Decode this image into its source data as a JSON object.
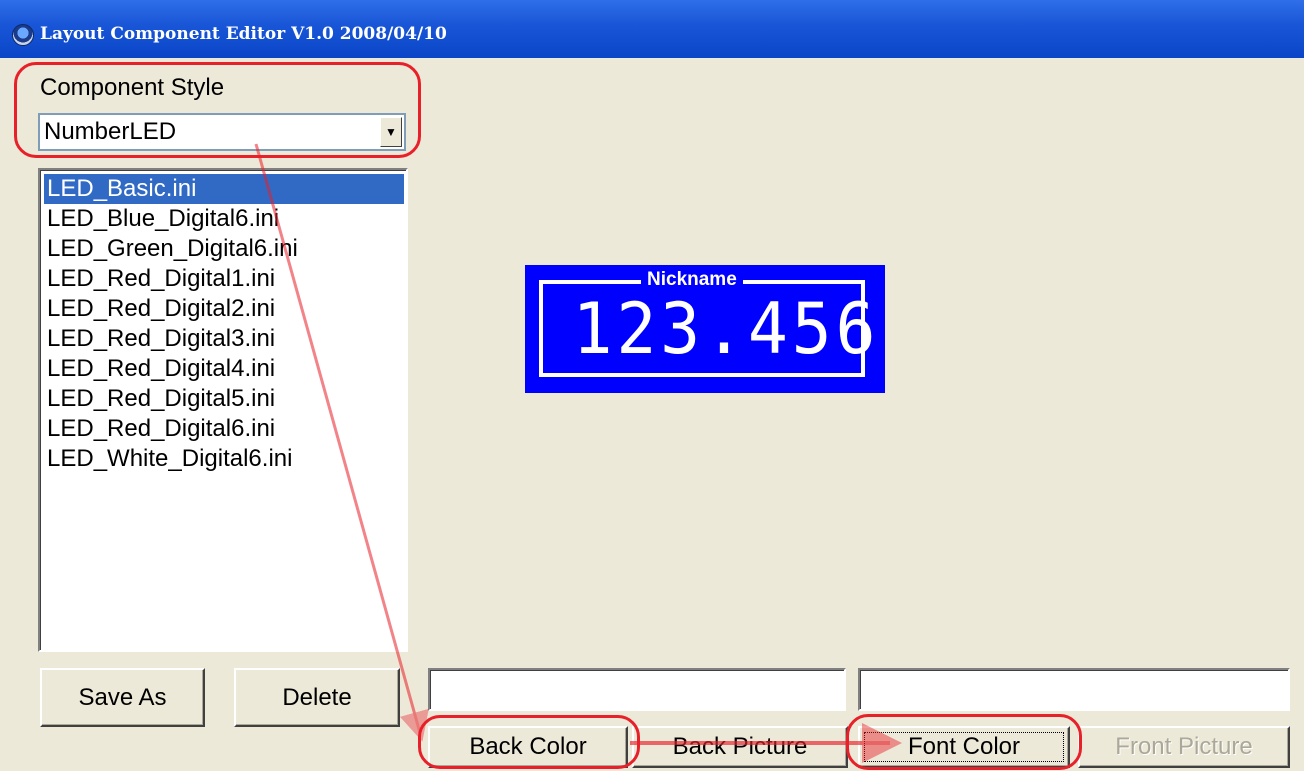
{
  "window": {
    "title": "Layout Component Editor V1.0  2008/04/10"
  },
  "component_style": {
    "label": "Component Style",
    "selected": "NumberLED"
  },
  "files": [
    "LED_Basic.ini",
    "LED_Blue_Digital6.ini",
    "LED_Green_Digital6.ini",
    "LED_Red_Digital1.ini",
    "LED_Red_Digital2.ini",
    "LED_Red_Digital3.ini",
    "LED_Red_Digital4.ini",
    "LED_Red_Digital5.ini",
    "LED_Red_Digital6.ini",
    "LED_White_Digital6.ini"
  ],
  "selected_file_index": 0,
  "buttons": {
    "save_as": "Save As",
    "delete": "Delete",
    "back_color": "Back Color",
    "back_picture": "Back Picture",
    "font_color": "Font Color",
    "front_picture": "Front Picture"
  },
  "preview": {
    "nickname": "Nickname",
    "value": "123.456",
    "back_color": "#0000ff",
    "font_color": "#ffffff"
  },
  "annotation_color": "#e8202a"
}
